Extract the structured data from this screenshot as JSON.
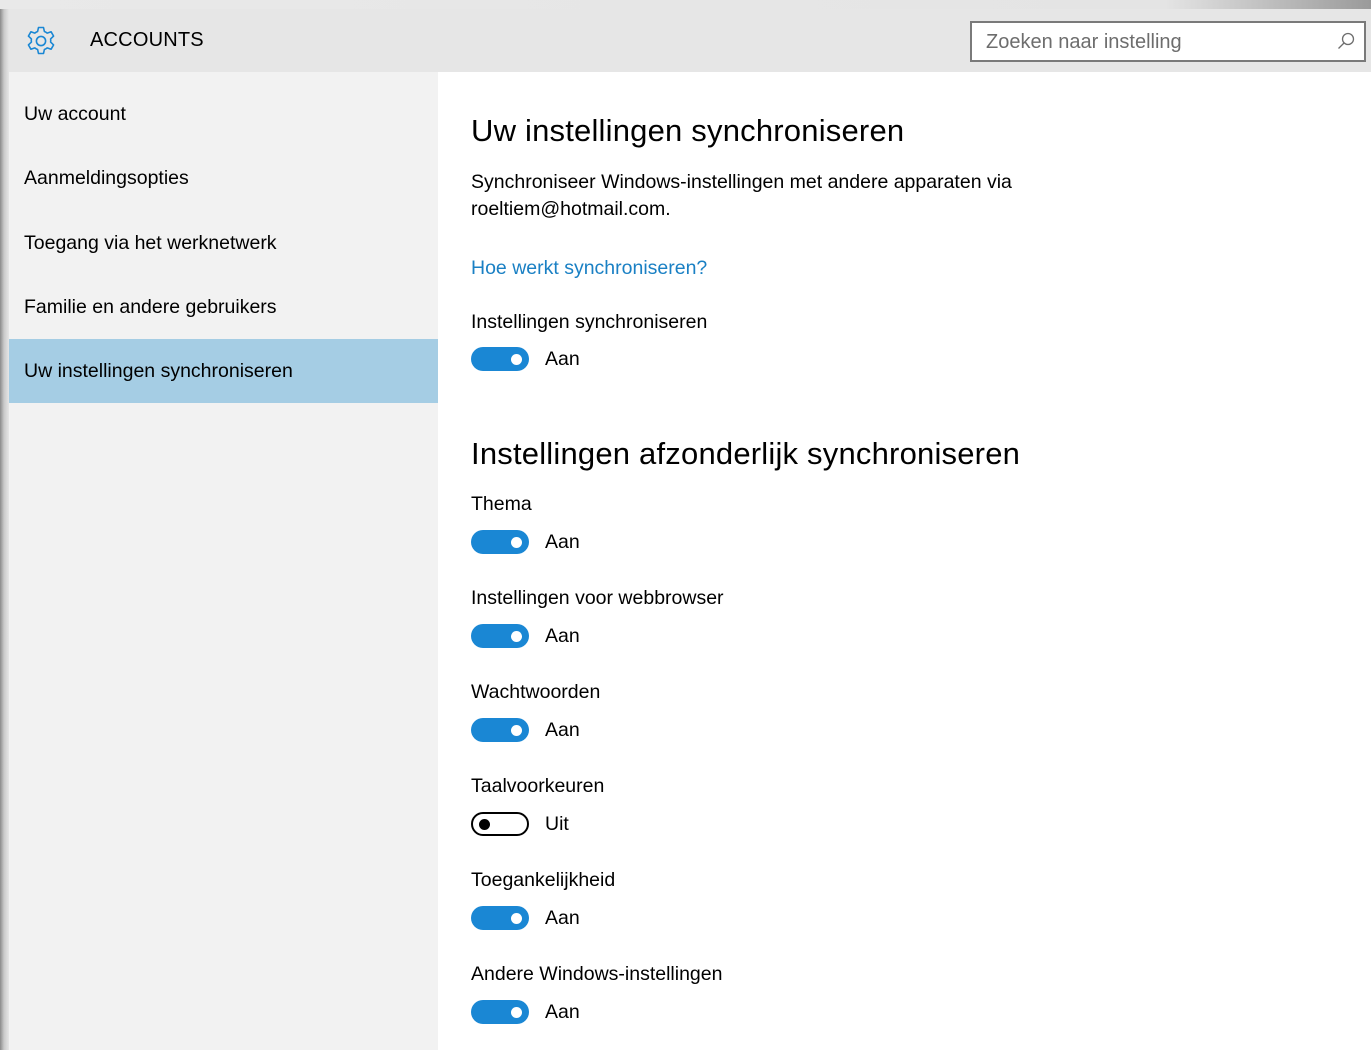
{
  "header": {
    "app_title": "ACCOUNTS",
    "app_icon": "gear-icon",
    "search_placeholder": "Zoeken naar instelling",
    "search_icon": "search-icon"
  },
  "sidebar": {
    "items": [
      {
        "label": "Uw account",
        "selected": false
      },
      {
        "label": "Aanmeldingsopties",
        "selected": false
      },
      {
        "label": "Toegang via het werknetwerk",
        "selected": false
      },
      {
        "label": "Familie en andere gebruikers",
        "selected": false
      },
      {
        "label": "Uw instellingen synchroniseren",
        "selected": true
      }
    ]
  },
  "main": {
    "title": "Uw instellingen synchroniseren",
    "description_line1": "Synchroniseer Windows-instellingen met andere apparaten via",
    "description_line2": "roeltiem@hotmail.com.",
    "help_link": "Hoe werkt synchroniseren?",
    "master": {
      "label": "Instellingen synchroniseren",
      "on": true,
      "state": "Aan"
    },
    "section_title": "Instellingen afzonderlijk synchroniseren",
    "settings": [
      {
        "label": "Thema",
        "on": true,
        "state": "Aan"
      },
      {
        "label": "Instellingen voor webbrowser",
        "on": true,
        "state": "Aan"
      },
      {
        "label": "Wachtwoorden",
        "on": true,
        "state": "Aan"
      },
      {
        "label": "Taalvoorkeuren",
        "on": false,
        "state": "Uit"
      },
      {
        "label": "Toegankelijkheid",
        "on": true,
        "state": "Aan"
      },
      {
        "label": "Andere Windows-instellingen",
        "on": true,
        "state": "Aan"
      }
    ]
  },
  "colors": {
    "accent": "#1a87d4",
    "link": "#1a80c4",
    "selected_nav": "#a5cde4",
    "sidebar_bg": "#f2f2f2",
    "titlebar_bg": "#e6e6e6"
  }
}
